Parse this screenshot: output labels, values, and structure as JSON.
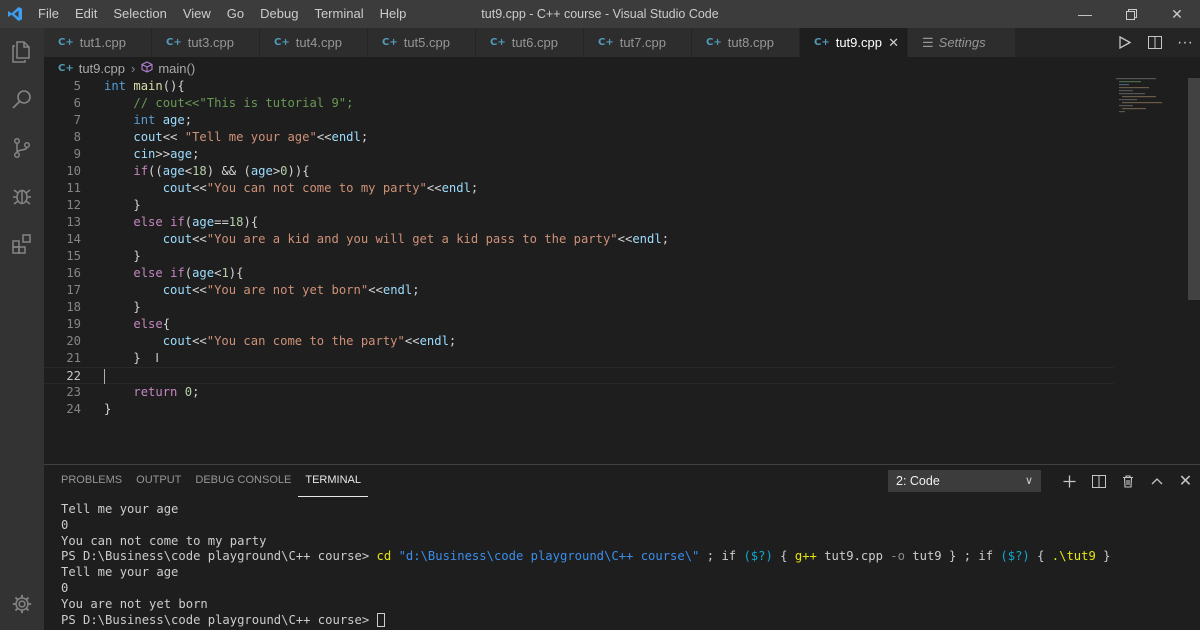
{
  "window": {
    "title": "tut9.cpp - C++ course - Visual Studio Code",
    "menu": [
      "File",
      "Edit",
      "Selection",
      "View",
      "Go",
      "Debug",
      "Terminal",
      "Help"
    ]
  },
  "tabs": [
    {
      "label": "tut1.cpp",
      "icon": "cpp-file-icon"
    },
    {
      "label": "tut3.cpp",
      "icon": "cpp-file-icon"
    },
    {
      "label": "tut4.cpp",
      "icon": "cpp-file-icon"
    },
    {
      "label": "tut5.cpp",
      "icon": "cpp-file-icon"
    },
    {
      "label": "tut6.cpp",
      "icon": "cpp-file-icon"
    },
    {
      "label": "tut7.cpp",
      "icon": "cpp-file-icon"
    },
    {
      "label": "tut8.cpp",
      "icon": "cpp-file-icon"
    },
    {
      "label": "tut9.cpp",
      "icon": "cpp-file-icon",
      "active": true
    },
    {
      "label": "Settings",
      "icon": "settings-list-icon"
    }
  ],
  "breadcrumb": {
    "file": "tut9.cpp",
    "symbol": "main()"
  },
  "editor": {
    "line_numbers": [
      "5",
      "6",
      "7",
      "8",
      "9",
      "10",
      "11",
      "12",
      "13",
      "14",
      "15",
      "16",
      "17",
      "18",
      "19",
      "20",
      "21",
      "22",
      "23",
      "24"
    ],
    "current_line": "22",
    "accent": "#569cd6"
  },
  "panel": {
    "tabs": [
      "PROBLEMS",
      "OUTPUT",
      "DEBUG CONSOLE",
      "TERMINAL"
    ],
    "active_tab": "TERMINAL",
    "terminal_select": "2: Code",
    "terminal": {
      "l1": "Tell me your age",
      "l2": "0",
      "l3": "You can not come to my party",
      "l4_prompt": "PS D:\\Business\\code playground\\C++ course>",
      "l4_cd": "cd",
      "l4_path": "\"d:\\Business\\code playground\\C++ course\\\"",
      "l4_sep1": ";",
      "l4_if1": "if",
      "l4_cond1": "($?)",
      "l4_open1": "{",
      "l4_gpp": "g++",
      "l4_file": "tut9.cpp",
      "l4_flag": "-o",
      "l4_out": "tut9",
      "l4_close1": "}",
      "l4_sep2": ";",
      "l4_if2": "if",
      "l4_cond2": "($?)",
      "l4_open2": "{",
      "l4_run": ".\\tut9",
      "l4_close2": "}",
      "l5": "Tell me your age",
      "l6": "0",
      "l7": "You are not yet born",
      "l8_prompt": "PS D:\\Business\\code playground\\C++ course>"
    }
  }
}
